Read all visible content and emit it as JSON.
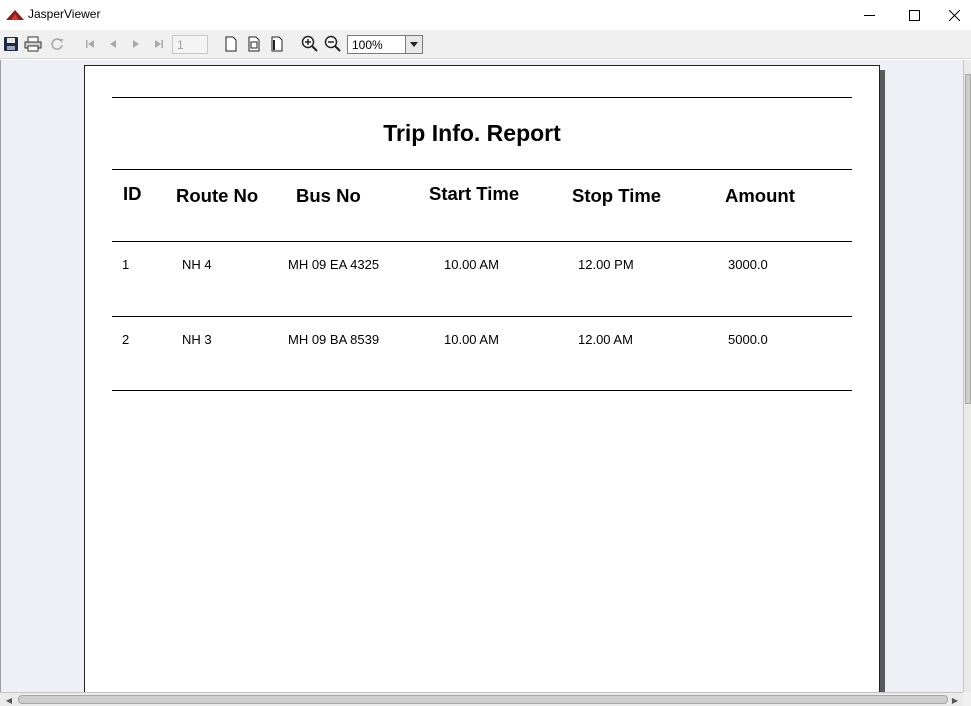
{
  "window": {
    "title": "JasperViewer"
  },
  "toolbar": {
    "page_number": "1",
    "zoom": "100%"
  },
  "report": {
    "title": "Trip Info. Report",
    "columns": [
      "ID",
      "Route No",
      "Bus No",
      "Start Time",
      "Stop Time",
      "Amount"
    ],
    "rows": [
      [
        "1",
        "NH 4",
        "MH 09 EA 4325",
        "10.00 AM",
        "12.00 PM",
        "3000.0"
      ],
      [
        "2",
        "NH 3",
        "MH 09 BA 8539",
        "10.00 AM",
        "12.00 AM",
        "5000.0"
      ]
    ]
  }
}
